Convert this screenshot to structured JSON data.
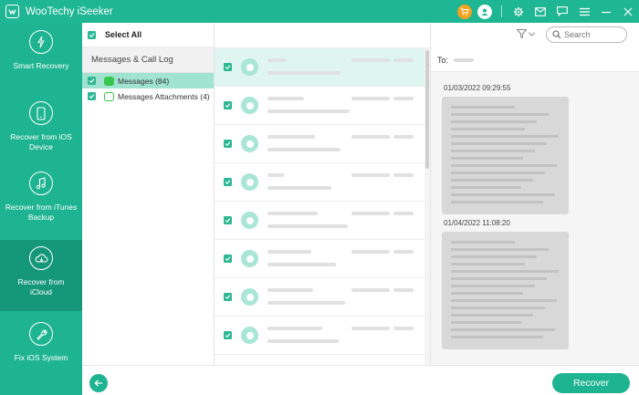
{
  "app": {
    "title": "WooTechy iSeeker"
  },
  "titlebar": {
    "icons": [
      "cart-icon",
      "user-icon",
      "gear-icon",
      "mail-icon",
      "feedback-icon",
      "menu-icon",
      "minimize-icon",
      "close-icon"
    ]
  },
  "sidebar": {
    "items": [
      {
        "label": "Smart Recovery",
        "icon": "smart-recovery-icon",
        "active": false
      },
      {
        "label": "Recover from iOS Device",
        "icon": "phone-icon",
        "active": false
      },
      {
        "label": "Recover from iTunes Backup",
        "icon": "music-note-icon",
        "active": false
      },
      {
        "label": "Recover from iCloud",
        "icon": "cloud-icon",
        "active": true
      },
      {
        "label": "Fix iOS System",
        "icon": "wrench-icon",
        "active": false
      }
    ]
  },
  "categories": {
    "select_all": "Select All",
    "header": "Messages & Call Log",
    "items": [
      {
        "label": "Messages (84)",
        "selected": true
      },
      {
        "label": "Messages Attachments (4)",
        "selected": false
      }
    ]
  },
  "toolbar": {
    "search_placeholder": "Search"
  },
  "detail": {
    "to_label": "To:",
    "dates": [
      "01/03/2022 09:29:55",
      "01/04/2022 11:08:20"
    ]
  },
  "footer": {
    "recover_label": "Recover"
  },
  "colors": {
    "brand": "#1eb491",
    "active_nav": "#159779",
    "selected_row": "#dff5ef"
  }
}
